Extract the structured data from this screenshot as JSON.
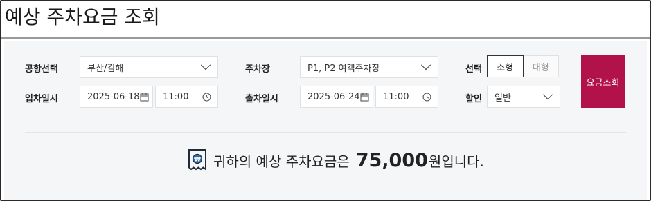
{
  "page": {
    "title": "예상 주차요금 조회"
  },
  "form": {
    "airport_label": "공항선택",
    "airport_value": "부산/김해",
    "parking_label": "주차장",
    "parking_value": "P1, P2 여객주차장",
    "type_label": "선택",
    "type_options": [
      "소형",
      "대형"
    ],
    "type_selected": "소형",
    "entry_label": "입차일시",
    "entry_date": "2025-06-18",
    "entry_time": "11:00",
    "exit_label": "출차일시",
    "exit_date": "2025-06-24",
    "exit_time": "11:00",
    "discount_label": "할인",
    "discount_value": "일반",
    "query_button": "요금조회"
  },
  "result": {
    "prefix": "귀하의 예상 주차요금은",
    "amount": "75,000",
    "suffix": "원입니다."
  },
  "colors": {
    "accent": "#b1124a",
    "panel_bg": "#f5f6f8",
    "border": "#dfe1e5"
  },
  "icons": [
    "chevron-down-icon",
    "calendar-icon",
    "clock-icon",
    "receipt-won-icon"
  ]
}
